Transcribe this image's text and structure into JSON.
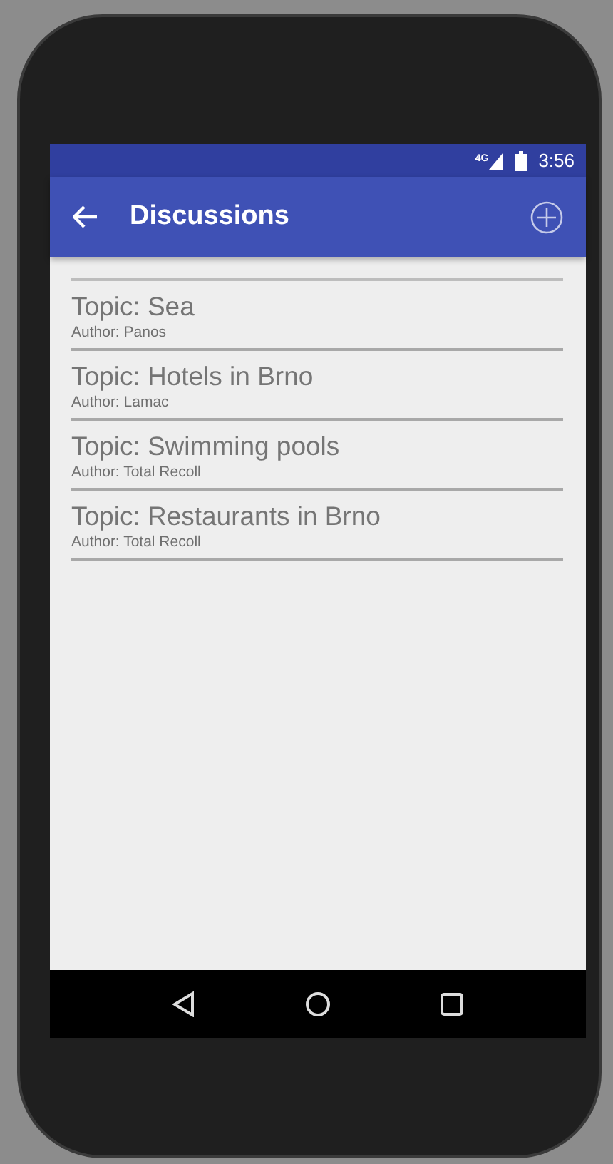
{
  "status_bar": {
    "network": "4G",
    "time": "3:56"
  },
  "toolbar": {
    "title": "Discussions"
  },
  "topics": [
    {
      "title": "Topic: Sea",
      "author": "Author: Panos"
    },
    {
      "title": "Topic: Hotels in Brno",
      "author": "Author: Lamac"
    },
    {
      "title": "Topic: Swimming pools",
      "author": "Author: Total Recoll"
    },
    {
      "title": "Topic: Restaurants in Brno",
      "author": "Author: Total Recoll"
    }
  ]
}
